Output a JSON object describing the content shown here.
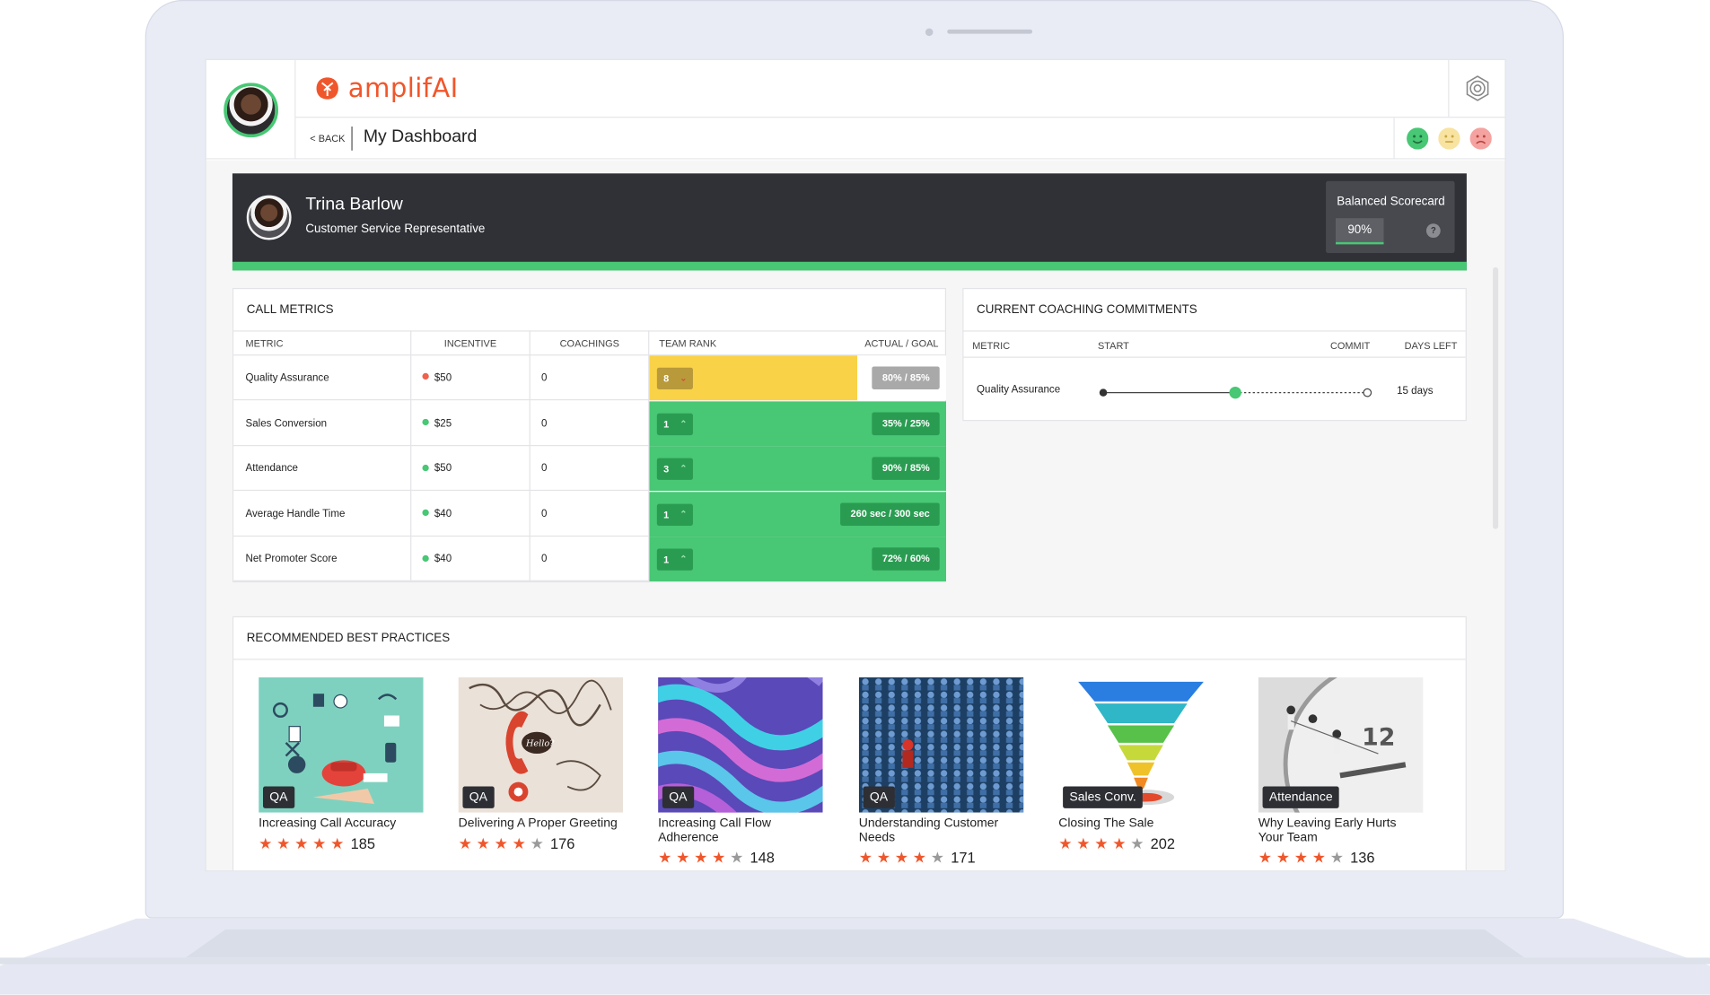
{
  "app": {
    "brand": "amplifAI",
    "back_label": "< BACK",
    "page_title": "My Dashboard"
  },
  "profile": {
    "name": "Trina Barlow",
    "role": "Customer Service Representative",
    "scorecard_title": "Balanced Scorecard",
    "scorecard_value": "90%",
    "help": "?"
  },
  "colors": {
    "brand": "#f0562b",
    "green": "#48c774",
    "yellow": "#f9d247",
    "red": "#f0604d",
    "dark": "#2f3137"
  },
  "call_metrics": {
    "title": "CALL METRICS",
    "columns": [
      "METRIC",
      "INCENTIVE",
      "COACHINGS",
      "TEAM RANK",
      "ACTUAL / GOAL"
    ],
    "rows": [
      {
        "metric": "Quality Assurance",
        "incentive": "$50",
        "incentive_status": "red",
        "coachings": "0",
        "rank": "8",
        "trend": "down",
        "actual_goal": "80% / 85%",
        "status": "yellow"
      },
      {
        "metric": "Sales Conversion",
        "incentive": "$25",
        "incentive_status": "green",
        "coachings": "0",
        "rank": "1",
        "trend": "up",
        "actual_goal": "35% / 25%",
        "status": "green"
      },
      {
        "metric": "Attendance",
        "incentive": "$50",
        "incentive_status": "green",
        "coachings": "0",
        "rank": "3",
        "trend": "up",
        "actual_goal": "90% / 85%",
        "status": "green"
      },
      {
        "metric": "Average Handle Time",
        "incentive": "$40",
        "incentive_status": "green",
        "coachings": "0",
        "rank": "1",
        "trend": "up",
        "actual_goal": "260 sec / 300 sec",
        "status": "green"
      },
      {
        "metric": "Net Promoter Score",
        "incentive": "$40",
        "incentive_status": "green",
        "coachings": "0",
        "rank": "1",
        "trend": "up",
        "actual_goal": "72% / 60%",
        "status": "green"
      }
    ]
  },
  "coaching": {
    "title": "CURRENT COACHING COMMITMENTS",
    "columns": [
      "METRIC",
      "START",
      "COMMIT",
      "DAYS LEFT"
    ],
    "row": {
      "metric": "Quality Assurance",
      "days_left": "15 days",
      "progress": 0.5
    }
  },
  "best_practices": {
    "title": "RECOMMENDED BEST PRACTICES",
    "cards": [
      {
        "tag": "QA",
        "title": "Increasing Call Accuracy",
        "rating": 5,
        "count": "185"
      },
      {
        "tag": "QA",
        "title": "Delivering A Proper Greeting",
        "rating": 4,
        "count": "176"
      },
      {
        "tag": "QA",
        "title": "Increasing Call Flow Adherence",
        "rating": 4,
        "count": "148"
      },
      {
        "tag": "QA",
        "title": "Understanding Customer Needs",
        "rating": 4,
        "count": "171"
      },
      {
        "tag": "Sales Conv.",
        "title": "Closing The Sale",
        "rating": 4,
        "count": "202"
      },
      {
        "tag": "Attendance",
        "title": "Why Leaving Early Hurts Your Team",
        "rating": 4,
        "count": "136"
      }
    ]
  },
  "icons": {
    "settings": "gear-icon",
    "mood_happy": "smiley-happy-icon",
    "mood_neutral": "smiley-neutral-icon",
    "mood_sad": "smiley-sad-icon"
  }
}
